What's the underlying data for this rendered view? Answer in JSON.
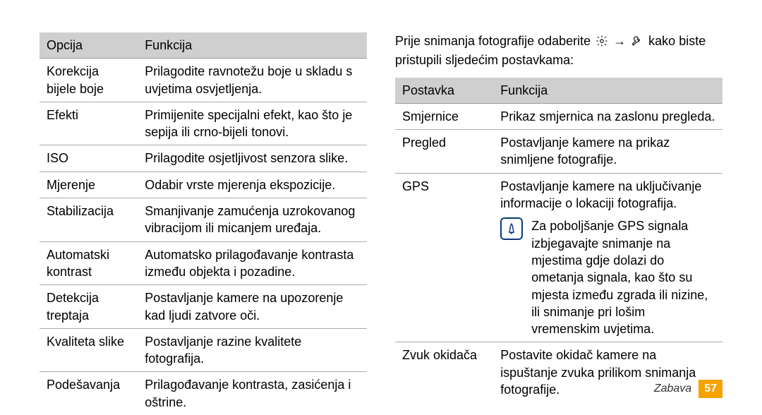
{
  "left_table": {
    "headers": [
      "Opcija",
      "Funkcija"
    ],
    "rows": [
      {
        "opt": "Korekcija bijele boje",
        "func": "Prilagodite ravnotežu boje u skladu s uvjetima osvjetljenja."
      },
      {
        "opt": "Efekti",
        "func": "Primijenite specijalni efekt, kao što je sepija ili crno-bijeli tonovi."
      },
      {
        "opt": "ISO",
        "func": "Prilagodite osjetljivost senzora slike."
      },
      {
        "opt": "Mjerenje",
        "func": "Odabir vrste mjerenja ekspozicije."
      },
      {
        "opt": "Stabilizacija",
        "func": "Smanjivanje zamućenja uzrokovanog vibracijom ili micanjem uređaja."
      },
      {
        "opt": "Automatski kontrast",
        "func": "Automatsko prilagođavanje kontrasta između objekta i pozadine."
      },
      {
        "opt": "Detekcija treptaja",
        "func": "Postavljanje kamere na upozorenje kad ljudi zatvore oči."
      },
      {
        "opt": "Kvaliteta slike",
        "func": "Postavljanje razine kvalitete fotografija."
      },
      {
        "opt": "Podešavanja",
        "func": "Prilagođavanje kontrasta, zasićenja i oštrine."
      }
    ]
  },
  "intro_pre": "Prije snimanja fotografije odaberite ",
  "intro_mid": " → ",
  "intro_post": " kako biste pristupili sljedećim postavkama:",
  "right_table": {
    "headers": [
      "Postavka",
      "Funkcija"
    ],
    "rows": [
      {
        "opt": "Smjernice",
        "func": "Prikaz smjernica na zaslonu pregleda."
      },
      {
        "opt": "Pregled",
        "func": "Postavljanje kamere na prikaz snimljene fotografije."
      },
      {
        "opt": "GPS",
        "func": "Postavljanje kamere na uključivanje informacije o lokaciji fotografija.",
        "note": "Za poboljšanje GPS signala izbjegavajte snimanje na mjestima gdje dolazi do ometanja signala, kao što su mjesta između zgrada ili nizine, ili snimanje pri lošim vremenskim uvjetima."
      },
      {
        "opt": "Zvuk okidača",
        "func": "Postavite okidač kamere na ispuštanje zvuka prilikom snimanja fotografije."
      }
    ]
  },
  "footer": {
    "section": "Zabava",
    "page": "57"
  }
}
